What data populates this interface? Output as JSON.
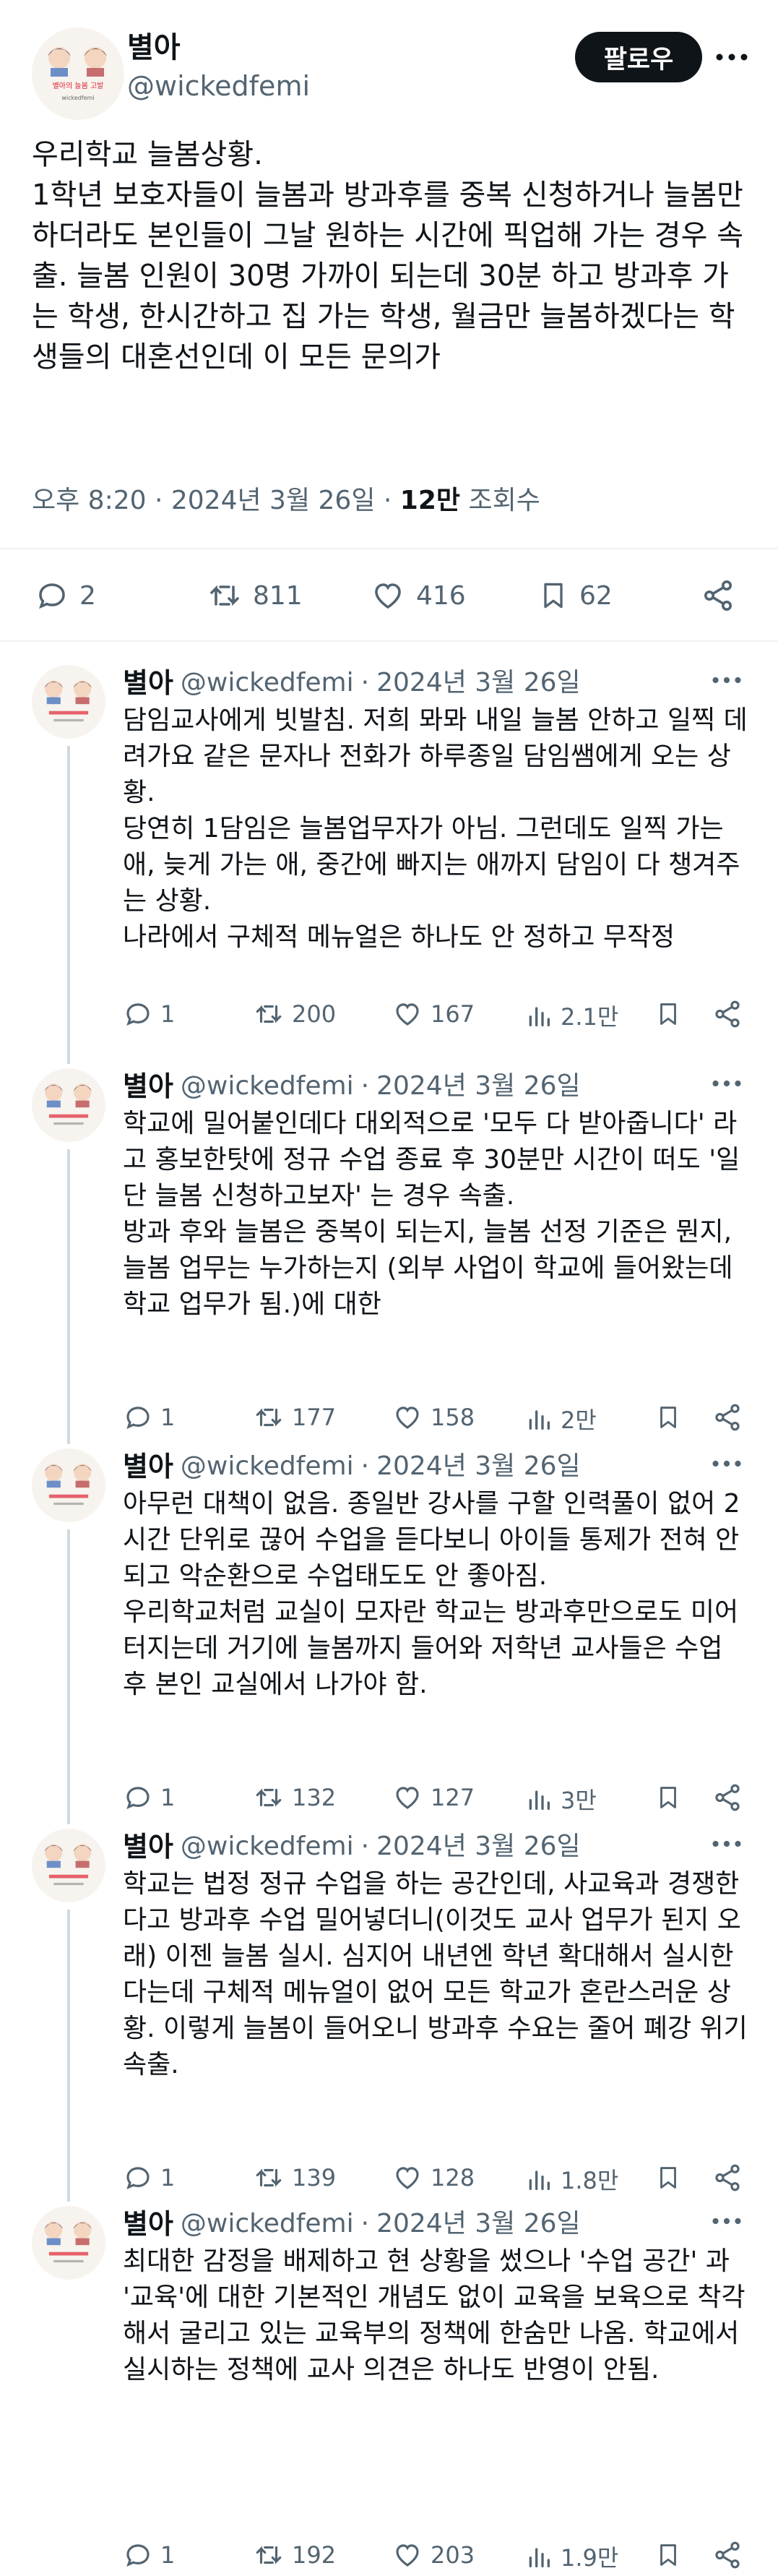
{
  "main": {
    "avatar_lines": [
      "별아의 늘봄 고발",
      "wickedfemi"
    ],
    "name": "별아",
    "handle": "@wickedfemi",
    "follow_label": "팔로우",
    "text": "우리학교 늘봄상황.\n1학년 보호자들이 늘봄과 방과후를 중복 신청하거나 늘봄만 하더라도 본인들이 그날 원하는 시간에 픽업해 가는 경우 속출. 늘봄 인원이 30명 가까이 되는데 30분 하고 방과후 가는 학생, 한시간하고 집 가는 학생, 월금만 늘봄하겠다는 학생들의 대혼선인데 이 모든 문의가",
    "time": "오후 8:20",
    "date": "2024년 3월 26일",
    "views_value": "12만",
    "views_label": "조회수",
    "replies": "2",
    "retweets": "811",
    "likes": "416",
    "bookmarks": "62"
  },
  "replies": [
    {
      "name": "별아",
      "handle": "@wickedfemi",
      "date": "2024년 3월 26일",
      "text": "담임교사에게 빗발침. 저희 뫄뫄 내일 늘봄 안하고 일찍 데려가요 같은 문자나 전화가 하루종일 담임쌤에게 오는 상황.\n당연히 1담임은 늘봄업무자가 아님. 그런데도 일찍 가는 애, 늦게 가는 애, 중간에 빠지는 애까지 담임이 다 챙겨주는 상황.\n나라에서 구체적 메뉴얼은 하나도 안 정하고 무작정",
      "replies": "1",
      "retweets": "200",
      "likes": "167",
      "views": "2.1만"
    },
    {
      "name": "별아",
      "handle": "@wickedfemi",
      "date": "2024년 3월 26일",
      "text": "학교에 밀어붙인데다 대외적으로 '모두 다 받아줍니다' 라고 홍보한탓에 정규 수업 종료 후 30분만 시간이 떠도 '일단 늘봄 신청하고보자' 는 경우 속출.\n방과 후와 늘봄은 중복이 되는지, 늘봄 선정 기준은 뭔지, 늘봄 업무는 누가하는지 (외부 사업이 학교에 들어왔는데 학교 업무가 됨.)에 대한",
      "replies": "1",
      "retweets": "177",
      "likes": "158",
      "views": "2만"
    },
    {
      "name": "별아",
      "handle": "@wickedfemi",
      "date": "2024년 3월 26일",
      "text": "아무런 대책이 없음. 종일반 강사를 구할 인력풀이 없어 2시간 단위로 끊어 수업을 듣다보니 아이들 통제가 전혀 안되고 악순환으로 수업태도도 안 좋아짐.\n우리학교처럼 교실이 모자란 학교는 방과후만으로도 미어터지는데 거기에 늘봄까지 들어와 저학년 교사들은 수업 후 본인 교실에서 나가야 함.",
      "replies": "1",
      "retweets": "132",
      "likes": "127",
      "views": "3만"
    },
    {
      "name": "별아",
      "handle": "@wickedfemi",
      "date": "2024년 3월 26일",
      "text": "학교는 법정 정규 수업을 하는 공간인데, 사교육과 경쟁한다고 방과후 수업 밀어넣더니(이것도 교사 업무가 된지 오래) 이젠 늘봄 실시. 심지어 내년엔 학년 확대해서 실시한다는데 구체적 메뉴얼이 없어 모든 학교가 혼란스러운 상황. 이렇게 늘봄이 들어오니 방과후 수요는 줄어 폐강 위기 속출.",
      "replies": "1",
      "retweets": "139",
      "likes": "128",
      "views": "1.8만"
    },
    {
      "name": "별아",
      "handle": "@wickedfemi",
      "date": "2024년 3월 26일",
      "text": "최대한 감정을 배제하고 현 상황을 썼으나 '수업 공간' 과 '교육'에 대한 기본적인 개념도 없이 교육을 보육으로 착각해서 굴리고 있는 교육부의 정책에 한숨만 나옴. 학교에서 실시하는 정책에 교사 의견은 하나도 반영이 안됨.",
      "replies": "1",
      "retweets": "192",
      "likes": "203",
      "views": "1.9만"
    }
  ]
}
